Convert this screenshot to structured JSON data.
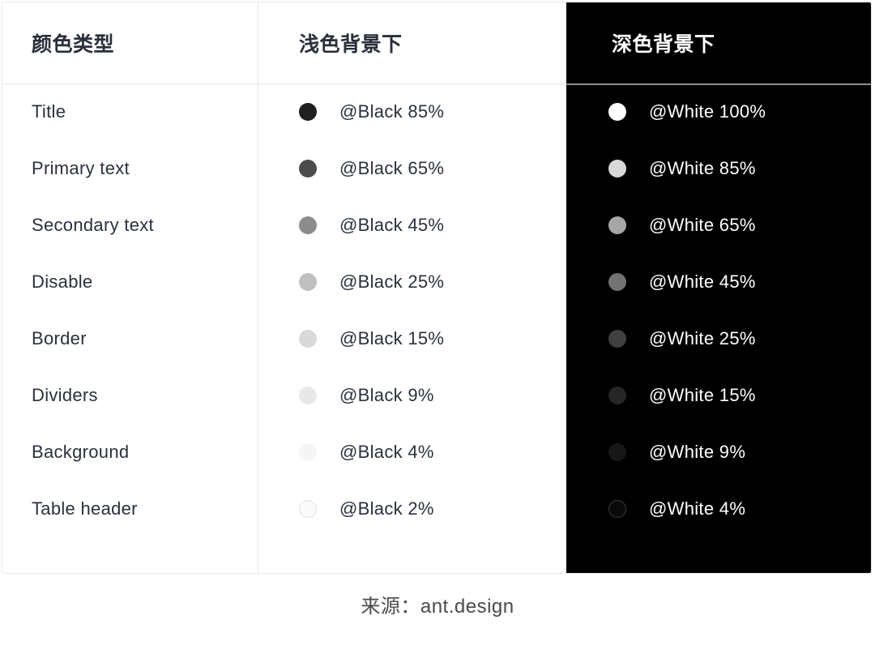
{
  "table": {
    "headers": {
      "col_type": "颜色类型",
      "col_light": "浅色背景下",
      "col_dark": "深色背景下"
    },
    "rows": [
      {
        "label": "Title",
        "light": {
          "token": "@Black 85%",
          "color": "#1f1f1f",
          "ringed": false
        },
        "dark": {
          "token": "@White 100%",
          "color": "#ffffff",
          "ringed": false
        }
      },
      {
        "label": "Primary text",
        "light": {
          "token": "@Black 65%",
          "color": "#4c4c4c",
          "ringed": false
        },
        "dark": {
          "token": "@White 85%",
          "color": "#d9d9d9",
          "ringed": false
        }
      },
      {
        "label": "Secondary text",
        "light": {
          "token": "@Black 45%",
          "color": "#8c8c8c",
          "ringed": false
        },
        "dark": {
          "token": "@White 65%",
          "color": "#a6a6a6",
          "ringed": false
        }
      },
      {
        "label": "Disable",
        "light": {
          "token": "@Black 25%",
          "color": "#bfbfbf",
          "ringed": false
        },
        "dark": {
          "token": "@White 45%",
          "color": "#737373",
          "ringed": false
        }
      },
      {
        "label": "Border",
        "light": {
          "token": "@Black 15%",
          "color": "#d9d9d9",
          "ringed": false
        },
        "dark": {
          "token": "@White 25%",
          "color": "#404040",
          "ringed": false
        }
      },
      {
        "label": "Dividers",
        "light": {
          "token": "@Black 9%",
          "color": "#e8e8e8",
          "ringed": false
        },
        "dark": {
          "token": "@White 15%",
          "color": "#262626",
          "ringed": false
        }
      },
      {
        "label": "Background",
        "light": {
          "token": "@Black 4%",
          "color": "#f5f5f5",
          "ringed": false
        },
        "dark": {
          "token": "@White 9%",
          "color": "#171717",
          "ringed": false
        }
      },
      {
        "label": "Table header",
        "light": {
          "token": "@Black 2%",
          "color": "#fafafa",
          "ringed": true
        },
        "dark": {
          "token": "@White 4%",
          "color": "#0a0a0a",
          "ringed": true
        }
      }
    ]
  },
  "footer": {
    "source": "来源：ant.design"
  },
  "theme": {
    "dark_panel_bg": "#000000",
    "border": "#e8e9ec",
    "text": "#2b303b",
    "text_on_dark": "#ffffff",
    "footer_text": "#4a4a4a"
  }
}
